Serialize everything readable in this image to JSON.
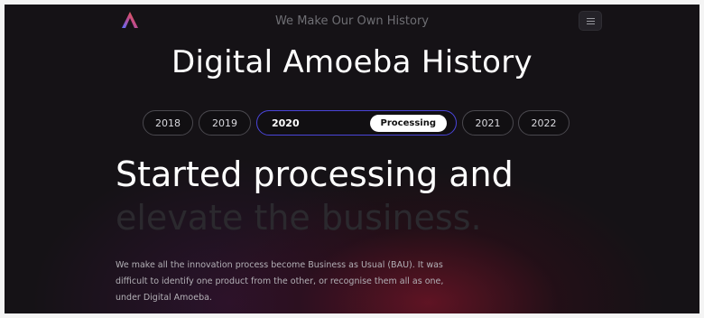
{
  "header": {
    "tagline": "We Make Our Own History"
  },
  "page": {
    "title": "Digital Amoeba History"
  },
  "timeline": {
    "years": [
      {
        "label": "2018"
      },
      {
        "label": "2019"
      },
      {
        "label": "2020",
        "status": "Processing",
        "active": true
      },
      {
        "label": "2021"
      },
      {
        "label": "2022"
      }
    ]
  },
  "content": {
    "headline_line1": "Started processing and",
    "headline_line2": "elevate the business.",
    "paragraph": "We make all the innovation process become Business as Usual (BAU). It was difficult to identify one product from the other, or recognise them all as one, under Digital Amoeba."
  },
  "icons": {
    "logo": "logo-icon",
    "menu": "hamburger-menu-icon"
  },
  "colors": {
    "background": "#151216",
    "active_border": "#4a45d9",
    "glow": "#781428"
  }
}
